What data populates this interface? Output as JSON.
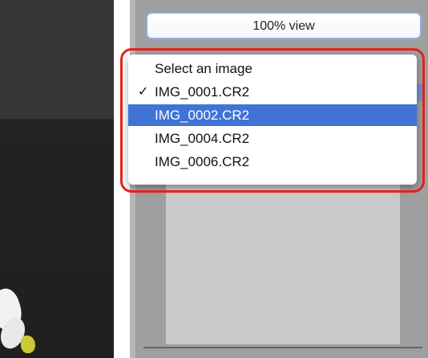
{
  "toolbar": {
    "view_label": "100% view"
  },
  "menu": {
    "items": [
      {
        "label": "Select an image",
        "checked": false,
        "highlighted": false
      },
      {
        "label": "IMG_0001.CR2",
        "checked": true,
        "highlighted": false
      },
      {
        "label": "IMG_0002.CR2",
        "checked": false,
        "highlighted": true
      },
      {
        "label": "IMG_0004.CR2",
        "checked": false,
        "highlighted": false
      },
      {
        "label": "IMG_0006.CR2",
        "checked": false,
        "highlighted": false
      }
    ],
    "check_glyph": "✓"
  },
  "colors": {
    "highlight": "#3f73d6",
    "callout_border": "#e2231a",
    "panel_bg": "#9f9f9f",
    "button_border": "#8fb0d6"
  }
}
